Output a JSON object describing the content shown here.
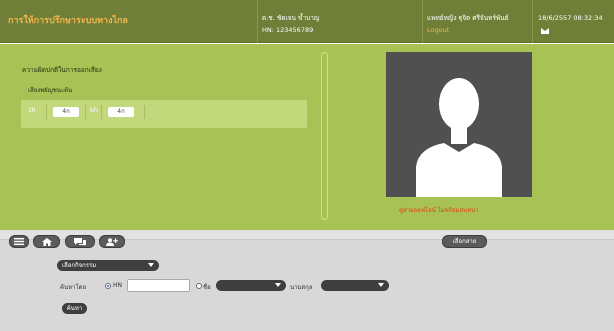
{
  "header": {
    "app_title": "การให้การปรึกษาระบบทางไกล",
    "patient_name": "ด.ช. ชัดเจน ข้ำบาญ",
    "patient_hn": "HN: 123456789",
    "doctor_name": "แพทย์หญิง ฐุจิต ศรีจันทร์พันธ์",
    "logout_label": "Logout",
    "datetime": "18/6/2557 08:32:34",
    "mail_icon": "mail-icon"
  },
  "main": {
    "title": "ความผิดปกติในการออกเสียง",
    "sub_label": "เสียงพยัญชนะต้น",
    "signals": [
      {
        "label": "th",
        "value": "4ก"
      },
      {
        "label": "kh",
        "value": "4ก"
      }
    ],
    "video_status": "คู่สายออฟไลน์ ไม่พร้อมสนทนา"
  },
  "toolbar": {
    "icons": [
      "menu-icon",
      "home-icon",
      "chat-icon",
      "add-user-icon"
    ],
    "choose_button": "เลือกสาย",
    "activity_select": "เลือกกิจกรรม",
    "search_by_label": "ค้นหาโดย",
    "hn_label": "HN",
    "hn_value": "",
    "name_label": "ชื่อ",
    "surname_label": "นามสกุล",
    "search_button": "ค้นหา"
  },
  "colors": {
    "header": "#6f7f38",
    "main": "#a8c256",
    "accent": "#f2b54b",
    "alert": "#d84416"
  }
}
